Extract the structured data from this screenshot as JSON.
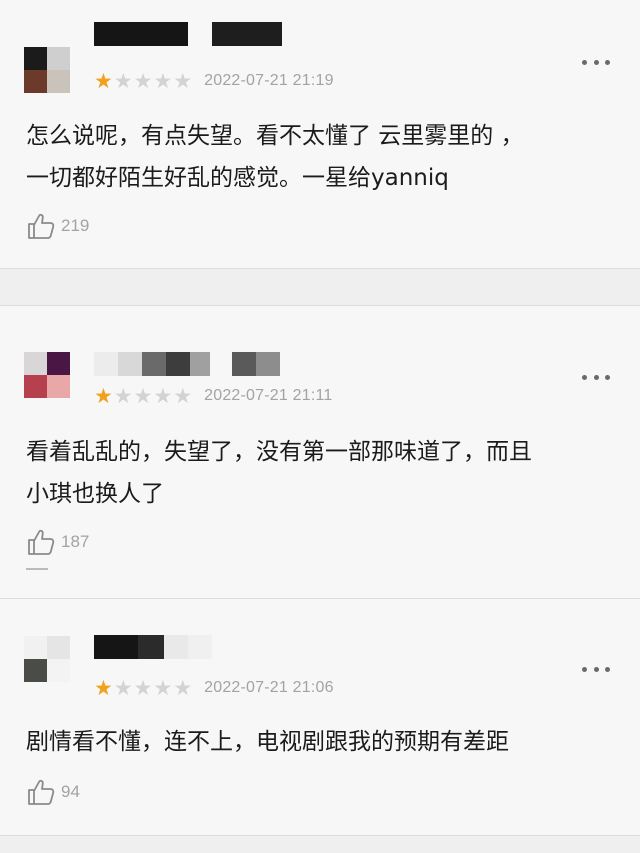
{
  "reviews": [
    {
      "date": "2022-07-21 21:19",
      "stars": 1,
      "content": "怎么说呢，有点失望。看不太懂了 云里雾里的 ，一切都好陌生好乱的感觉。一星给yanniq",
      "content_line1": "怎么说呢，有点失望。看不太懂了 云里雾里的 ，",
      "content_line2": "一切都好陌生好乱的感觉。一星给yanniq",
      "likes": "219",
      "avatar_colors": [
        "#1b1b1b",
        "#cfcfcf",
        "#6b3a2a",
        "#c9c3bb"
      ],
      "name_colors": [
        "#1a1a1a",
        "#1a1a1a",
        "#ffffff",
        "#1a1a1a",
        "#151515"
      ]
    },
    {
      "date": "2022-07-21 21:11",
      "stars": 1,
      "content": "看着乱乱的，失望了，没有第一部那味道了，而且小琪也换人了",
      "content_line1": "看着乱乱的，失望了，没有第一部那味道了，而且",
      "content_line2": "小琪也换人了",
      "likes": "187",
      "avatar_colors": [
        "#d9d6d7",
        "#4a1744",
        "#b6404e",
        "#e8a8a8"
      ],
      "name_colors": [
        "#eeeeee",
        "#d8d8d8",
        "#6a6a6a",
        "#3d3d3d",
        "#a0a0a0",
        "#ffffff",
        "#5a5a5a",
        "#8d8d8d"
      ]
    },
    {
      "date": "2022-07-21 21:06",
      "stars": 1,
      "content": "剧情看不懂，连不上，电视剧跟我的预期有差距",
      "content_line1": "剧情看不懂，连不上，电视剧跟我的预期有差距",
      "likes": "94",
      "avatar_colors": [
        "#f1f1f1",
        "#e5e5e5",
        "#4a4d47",
        "#f3f3f3"
      ],
      "name_colors": [
        "#151515",
        "#2b2b2b",
        "#e9e9e9",
        "#f0f0f0"
      ]
    }
  ],
  "colors": {
    "star_on": "#f0a21c",
    "star_off": "#d3d3d3",
    "meta_text": "#a3a3a3",
    "body_text": "#1b1b1b",
    "background": "#f7f7f7"
  },
  "icons": {
    "more": "more-icon",
    "like": "thumbs-up-icon",
    "star": "star-icon"
  }
}
